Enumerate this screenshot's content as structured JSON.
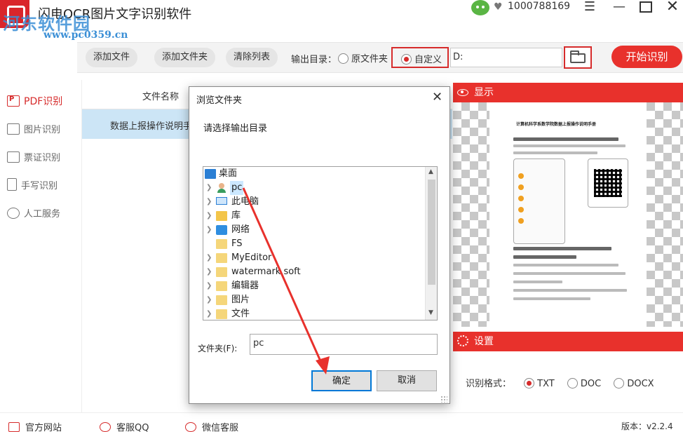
{
  "app": {
    "title": "闪电OCR图片文字识别软件",
    "user_id": "1000788169",
    "watermark_site": "河东软件园",
    "watermark_url": "www.pc0359.cn"
  },
  "toolbar": {
    "add_file": "添加文件",
    "add_folder": "添加文件夹",
    "clear_list": "清除列表",
    "output_dir_label": "输出目录：",
    "opt_original": "原文件夹",
    "opt_custom": "自定义",
    "output_path": "D:",
    "start_button": "开始识别"
  },
  "sidebar": {
    "items": [
      {
        "label": "PDF识别"
      },
      {
        "label": "图片识别"
      },
      {
        "label": "票证识别"
      },
      {
        "label": "手写识别"
      },
      {
        "label": "人工服务"
      }
    ]
  },
  "file_list": {
    "column_name": "文件名称",
    "rows": [
      "数据上报操作说明手册"
    ]
  },
  "preview": {
    "header": "显示",
    "doc_title": "计算机科学系数学院数据上报操作说明手册"
  },
  "settings": {
    "header": "设置",
    "format_label": "识别格式：",
    "formats": [
      "TXT",
      "DOC",
      "DOCX"
    ],
    "selected": "TXT"
  },
  "footer": {
    "website": "官方网站",
    "qq": "客服QQ",
    "wechat": "微信客服",
    "version": "版本：v2.2.4"
  },
  "dialog": {
    "title": "浏览文件夹",
    "prompt": "请选择输出目录",
    "tree": [
      "桌面",
      "pc",
      "此电脑",
      "库",
      "网络",
      "FS",
      "MyEditor",
      "watermark soft",
      "编辑器",
      "图片",
      "文件"
    ],
    "folder_label": "文件夹(F):",
    "folder_value": "pc",
    "ok": "确定",
    "cancel": "取消"
  },
  "colors": {
    "accent": "#e8312c",
    "highlight_row": "#cce5f6",
    "dialog_focus": "#0078d7"
  }
}
